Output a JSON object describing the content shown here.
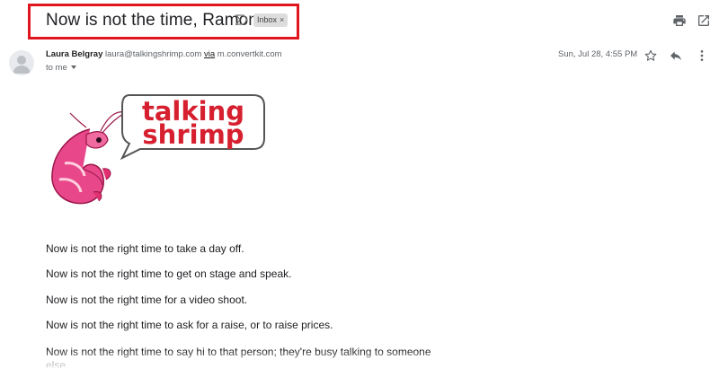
{
  "email": {
    "subject": "Now is not the time, Ramona",
    "label": "Inbox",
    "label_close": "×",
    "sender_name": "Laura Belgray",
    "sender_email": "laura@talkingshrimp.com",
    "via_text": "via",
    "via_domain": "m.convertkit.com",
    "to_text": "to me",
    "date": "Sun, Jul 28, 4:55 PM"
  },
  "logo": {
    "line1": "talking",
    "line2": "shrimp"
  },
  "body": {
    "paragraphs": [
      "Now is not the right time to take a day off.",
      "Now is not the right time to get on stage and speak.",
      "Now is not the right time for a video shoot.",
      "Now is not the right time to ask for a raise, or to raise prices.",
      "Now is not the right time to say hi to that person; they're busy talking to someone else."
    ]
  },
  "icons": [
    "importance-icon",
    "print-icon",
    "popout-icon",
    "avatar-icon",
    "star-icon",
    "reply-icon",
    "more-vert-icon",
    "caret-icon"
  ],
  "colors": {
    "highlight": "#e0161e",
    "logo_red": "#d6202f",
    "shrimp_pink": "#e8478a"
  }
}
